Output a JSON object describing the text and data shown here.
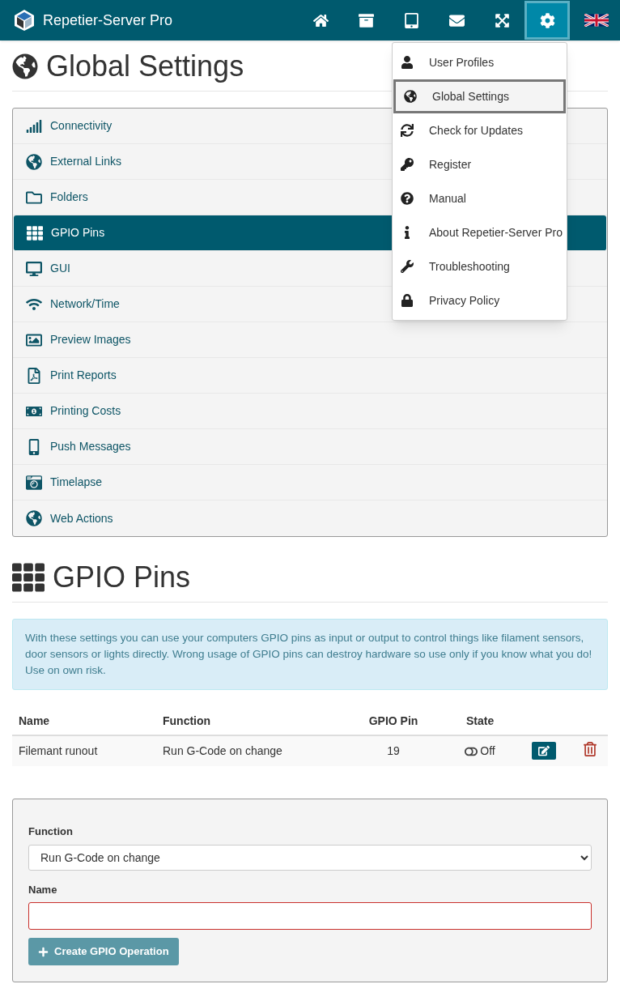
{
  "navbar": {
    "brand": "Repetier-Server Pro",
    "items": [
      {
        "selected": false
      },
      {
        "selected": false
      },
      {
        "selected": false
      },
      {
        "selected": false
      },
      {
        "selected": false
      },
      {
        "selected": true
      }
    ]
  },
  "menu": {
    "items": [
      {
        "label": "User Profiles",
        "selected": false
      },
      {
        "label": "Global Settings",
        "selected": true
      },
      {
        "label": "Check for Updates",
        "selected": false
      },
      {
        "label": "Register",
        "selected": false
      },
      {
        "label": "Manual",
        "selected": false
      },
      {
        "label": "About Repetier-Server Pro",
        "selected": false
      },
      {
        "label": "Troubleshooting",
        "selected": false
      },
      {
        "label": "Privacy Policy",
        "selected": false
      }
    ]
  },
  "page_title": "Global Settings",
  "settings_list": [
    {
      "label": "Connectivity",
      "selected": false
    },
    {
      "label": "External Links",
      "selected": false
    },
    {
      "label": "Folders",
      "selected": false
    },
    {
      "label": "GPIO Pins",
      "selected": true
    },
    {
      "label": "GUI",
      "selected": false
    },
    {
      "label": "Network/Time",
      "selected": false
    },
    {
      "label": "Preview Images",
      "selected": false
    },
    {
      "label": "Print Reports",
      "selected": false
    },
    {
      "label": "Printing Costs",
      "selected": false
    },
    {
      "label": "Push Messages",
      "selected": false
    },
    {
      "label": "Timelapse",
      "selected": false
    },
    {
      "label": "Web Actions",
      "selected": false
    }
  ],
  "section_title": "GPIO Pins",
  "notice": "With these settings you can use your computers GPIO pins as input or output to control things like filament sensors, door sensors or lights directly. Wrong usage of GPIO pins can destroy hardware so use only if you know what you do! Use on own risk.",
  "table": {
    "columns": [
      "Name",
      "Function",
      "GPIO Pin",
      "State"
    ],
    "rows": [
      {
        "name": "Filemant runout",
        "function": "Run G-Code on change",
        "pin": "19",
        "state": {
          "on": false,
          "label": "Off"
        }
      }
    ]
  },
  "form": {
    "function_label": "Function",
    "function_value": "Run G-Code on change",
    "name_label": "Name",
    "name_invalid": true,
    "button": {
      "label": "Create GPIO Operation",
      "disabled": true
    }
  }
}
